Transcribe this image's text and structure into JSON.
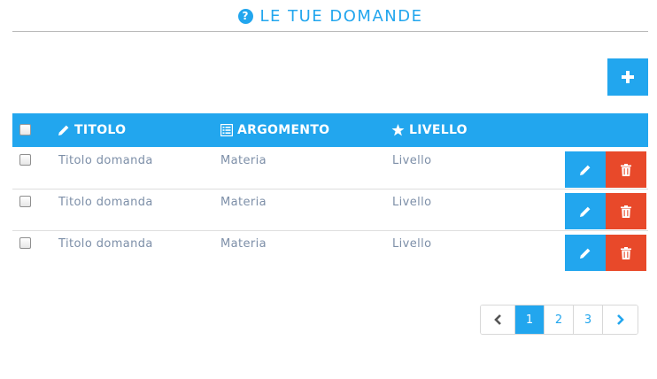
{
  "header": {
    "title": "LE TUE DOMANDE",
    "icon": "question-circle-icon"
  },
  "toolbar": {
    "add_icon": "plus-icon"
  },
  "table": {
    "columns": [
      {
        "label": "TITOLO",
        "icon": "pencil-icon"
      },
      {
        "label": "ARGOMENTO",
        "icon": "list-alt-icon"
      },
      {
        "label": "LIVELLO",
        "icon": "star-icon"
      }
    ],
    "rows": [
      {
        "title": "Titolo domanda",
        "subject": "Materia",
        "level": "Livello"
      },
      {
        "title": "Titolo domanda",
        "subject": "Materia",
        "level": "Livello"
      },
      {
        "title": "Titolo domanda",
        "subject": "Materia",
        "level": "Livello"
      }
    ]
  },
  "pagination": {
    "pages": [
      "1",
      "2",
      "3"
    ],
    "active": "1",
    "prev_icon": "chevron-left-icon",
    "next_icon": "chevron-right-icon"
  },
  "colors": {
    "accent": "#22a6ee",
    "danger": "#e8492a",
    "cell_text": "#7d8fa8"
  }
}
